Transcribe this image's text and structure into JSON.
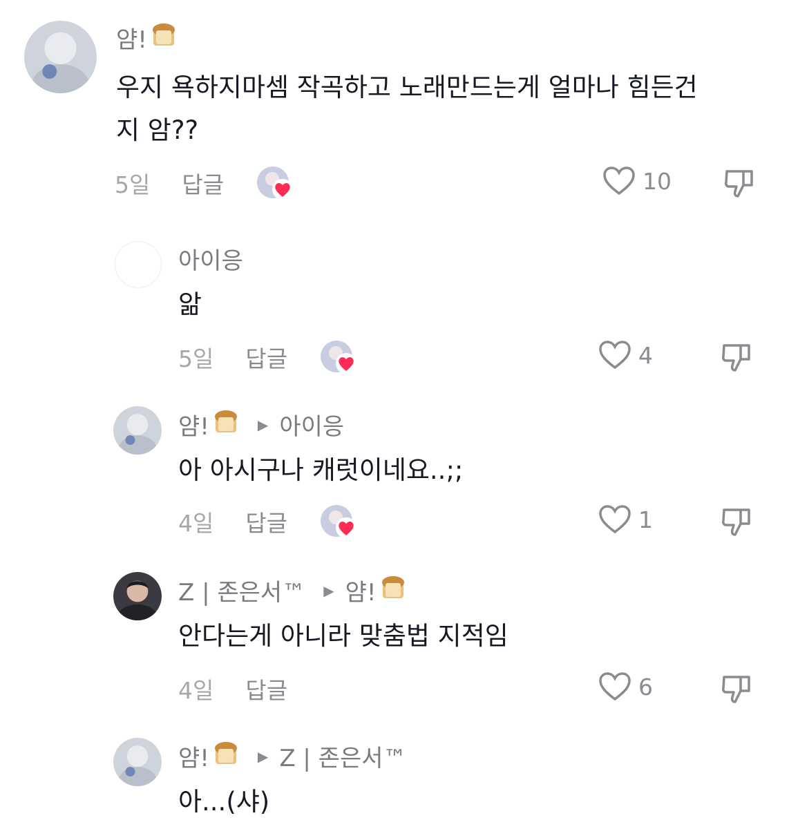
{
  "comments": [
    {
      "author": "얌!",
      "reply_to": "",
      "text_line1": "우지 욕하지마셈 작곡하고 노래만드는게 얼마나 힘든건",
      "text_line2": "지 암??",
      "date": "5일",
      "reply_label": "답글",
      "likes": "10"
    },
    {
      "author": "아이응",
      "reply_to": "",
      "text": "앎",
      "date": "5일",
      "reply_label": "답글",
      "likes": "4"
    },
    {
      "author": "얌!",
      "reply_to": "아이응",
      "text": "아 아시구나 캐럿이네요..;;",
      "date": "4일",
      "reply_label": "답글",
      "likes": "1"
    },
    {
      "author": "Z | 존은서™",
      "reply_to": "얌!",
      "text": "안다는게 아니라 맞춤법 지적임",
      "date": "4일",
      "reply_label": "답글",
      "likes": "6"
    },
    {
      "author": "얌!",
      "reply_to": "Z | 존은서™",
      "text": "아...(샤)"
    }
  ],
  "icons": {
    "like": "heart-outline-icon",
    "dislike": "thumbs-down-icon",
    "creator_liked": "creator-heart-badge-icon",
    "emoji": "bread-emoji"
  },
  "colors": {
    "text": "#161823",
    "secondary": "#7a7b80",
    "heart_badge": "#fe2c55"
  }
}
